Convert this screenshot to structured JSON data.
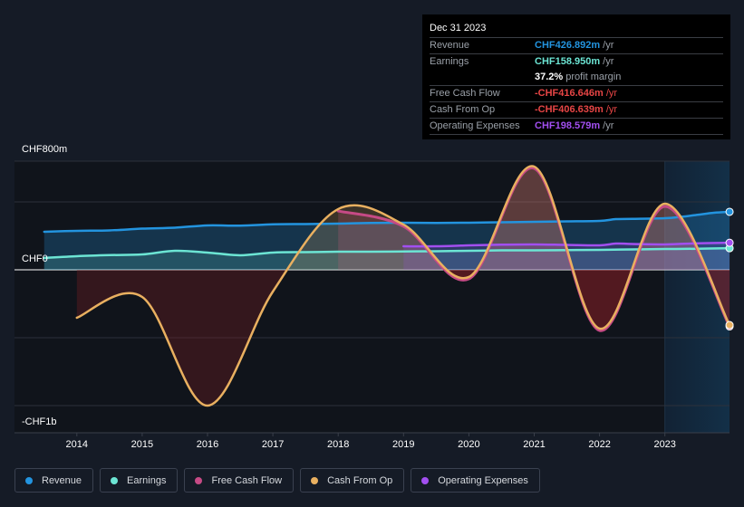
{
  "tooltip": {
    "date": "Dec 31 2023",
    "rows": [
      {
        "label": "Revenue",
        "value": "CHF426.892m",
        "unit": "/yr",
        "color": "#2394df"
      },
      {
        "label": "Earnings",
        "value": "CHF158.950m",
        "unit": "/yr",
        "color": "#6ce5d4"
      },
      {
        "label": "",
        "value": "37.2%",
        "unit": "profit margin",
        "color": "#ffffff"
      },
      {
        "label": "Free Cash Flow",
        "value": "-CHF416.646m",
        "unit": "/yr",
        "color": "#e64545"
      },
      {
        "label": "Cash From Op",
        "value": "-CHF406.639m",
        "unit": "/yr",
        "color": "#e64545"
      },
      {
        "label": "Operating Expenses",
        "value": "CHF198.579m",
        "unit": "/yr",
        "color": "#a24ff0"
      }
    ]
  },
  "legend": [
    {
      "label": "Revenue",
      "color": "#2394df"
    },
    {
      "label": "Earnings",
      "color": "#6ce5d4"
    },
    {
      "label": "Free Cash Flow",
      "color": "#c64a85"
    },
    {
      "label": "Cash From Op",
      "color": "#e9b060"
    },
    {
      "label": "Operating Expenses",
      "color": "#a24ff0"
    }
  ],
  "chart_data": {
    "type": "line",
    "title": "",
    "xlabel": "",
    "ylabel": "",
    "unit": "CHF m",
    "y_tick_labels": [
      {
        "value": 800,
        "label": "CHF800m"
      },
      {
        "value": 0,
        "label": "CHF0"
      },
      {
        "value": -1000,
        "label": "-CHF1b"
      }
    ],
    "y_gridlines": [
      800,
      500,
      0,
      -500,
      -1000
    ],
    "ylim": [
      -1200,
      800
    ],
    "xlim": [
      2013.0,
      2024.0
    ],
    "x_tick_labels": [
      "2014",
      "2015",
      "2016",
      "2017",
      "2018",
      "2019",
      "2020",
      "2021",
      "2022",
      "2023"
    ],
    "x_ticks": [
      2014,
      2015,
      2016,
      2017,
      2018,
      2019,
      2020,
      2021,
      2022,
      2023
    ],
    "highlight_from": 2023.0,
    "highlight_to": 2023.99,
    "series": [
      {
        "name": "Revenue",
        "color": "#2394df",
        "fill": true,
        "x": [
          2013.5,
          2014,
          2014.5,
          2015,
          2015.5,
          2016,
          2016.5,
          2017,
          2017.5,
          2018,
          2018.5,
          2019,
          2019.5,
          2020,
          2020.5,
          2021,
          2021.5,
          2022,
          2022.25,
          2022.5,
          2023,
          2023.25,
          2023.5,
          2023.75,
          2023.99
        ],
        "y": [
          280,
          287,
          290,
          303,
          310,
          327,
          325,
          335,
          337,
          340,
          345,
          347,
          345,
          347,
          350,
          353,
          357,
          360,
          373,
          375,
          380,
          390,
          405,
          420,
          427
        ]
      },
      {
        "name": "Earnings",
        "color": "#6ce5d4",
        "fill": true,
        "x": [
          2013.5,
          2014,
          2014.5,
          2015,
          2015.5,
          2016,
          2016.5,
          2017,
          2017.5,
          2018,
          2018.5,
          2019,
          2019.5,
          2020,
          2020.5,
          2021,
          2021.5,
          2022,
          2022.5,
          2023,
          2023.5,
          2023.99
        ],
        "y": [
          87,
          100,
          108,
          113,
          140,
          127,
          107,
          127,
          130,
          133,
          133,
          135,
          137,
          140,
          143,
          143,
          145,
          147,
          150,
          153,
          155,
          159
        ]
      },
      {
        "name": "Free Cash Flow",
        "color": "#c64a85",
        "fill": true,
        "x": [
          2018,
          2019,
          2020,
          2021,
          2022,
          2023,
          2023.99
        ],
        "y": [
          433,
          320,
          -67,
          747,
          -447,
          467,
          -417
        ]
      },
      {
        "name": "Cash From Op",
        "color": "#e9b060",
        "fill": true,
        "x": [
          2014,
          2015,
          2016,
          2017,
          2018,
          2019,
          2020,
          2021,
          2022,
          2023,
          2023.99
        ],
        "y": [
          -353,
          -200,
          -1000,
          -160,
          447,
          333,
          -53,
          760,
          -433,
          487,
          -407
        ]
      },
      {
        "name": "Operating Expenses",
        "color": "#a24ff0",
        "fill": true,
        "x": [
          2019,
          2019.5,
          2020,
          2020.5,
          2021,
          2021.5,
          2022,
          2022.25,
          2022.5,
          2023,
          2023.5,
          2023.99
        ],
        "y": [
          173,
          173,
          180,
          185,
          187,
          183,
          180,
          193,
          190,
          187,
          195,
          199
        ]
      }
    ]
  }
}
